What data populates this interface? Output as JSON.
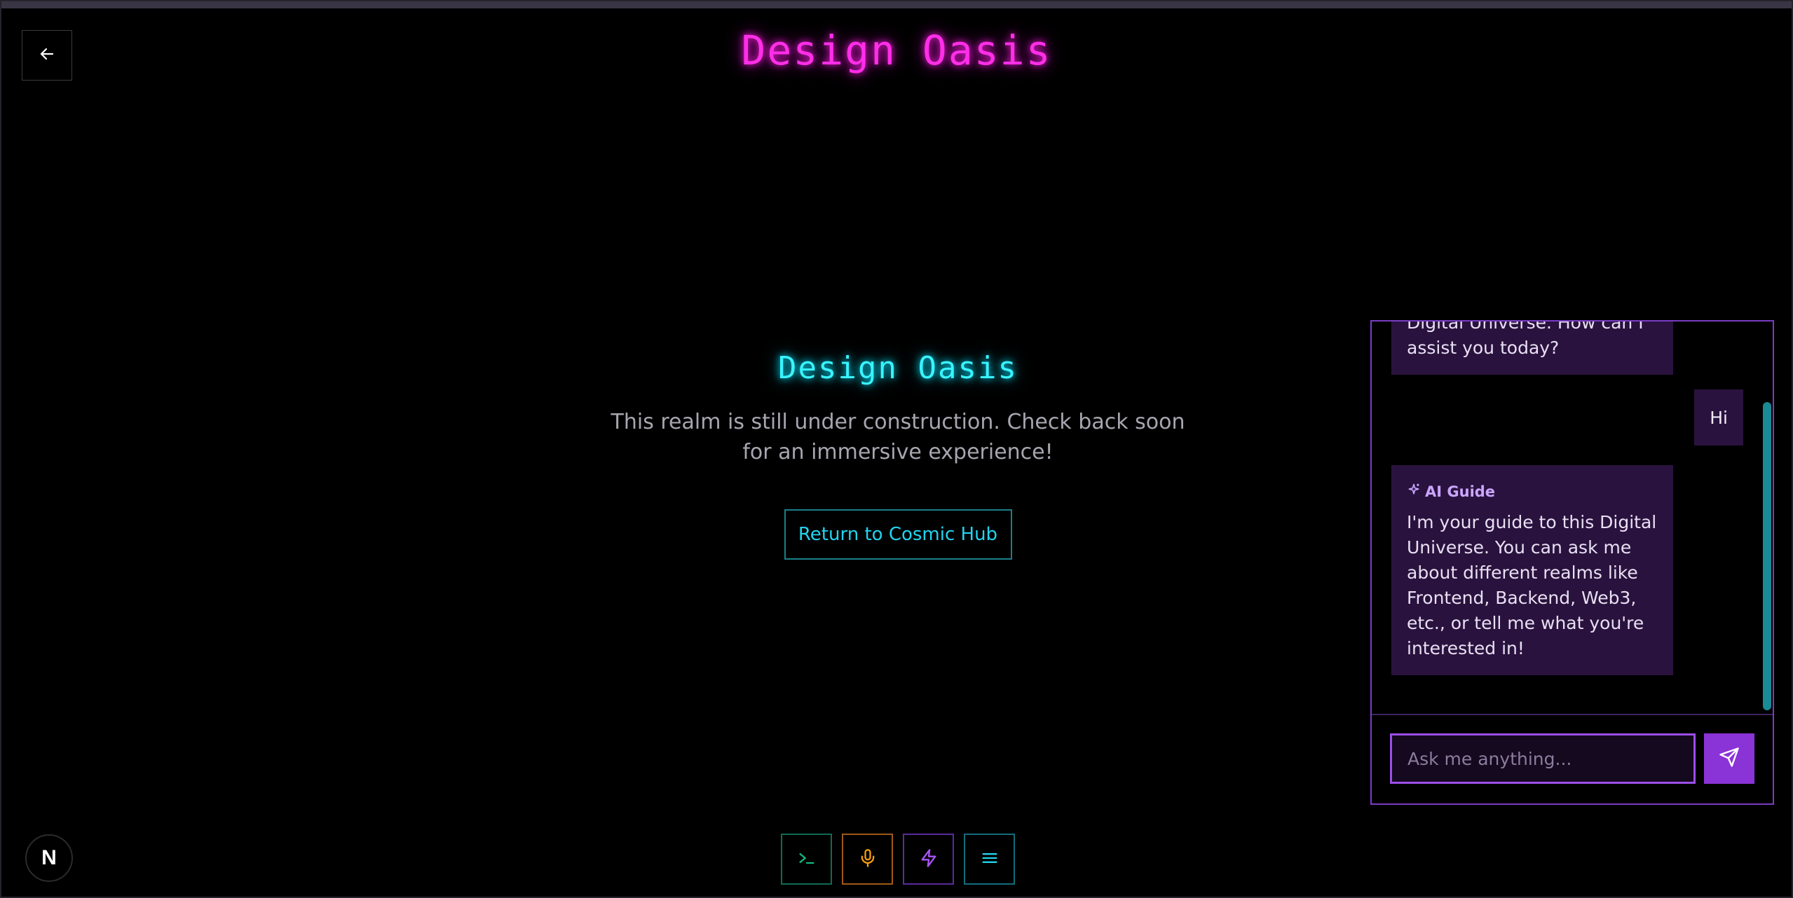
{
  "header": {
    "back_icon": "arrow-left-icon",
    "title": "Design Oasis"
  },
  "main": {
    "realm_title": "Design Oasis",
    "description": "This realm is still under construction. Check back soon for an immersive experience!",
    "return_button": "Return to Cosmic Hub"
  },
  "chat": {
    "messages": [
      {
        "role": "ai",
        "text": "Digital Universe. How can I assist you today?"
      },
      {
        "role": "user",
        "text": "Hi"
      },
      {
        "role": "ai",
        "label": "AI Guide",
        "text": "I'm your guide to this Digital Universe. You can ask me about different realms like Frontend, Backend, Web3, etc., or tell me what you're interested in!"
      }
    ],
    "input_placeholder": "Ask me anything...",
    "input_value": "",
    "send_icon": "send-icon"
  },
  "dock": [
    {
      "icon": "terminal-icon",
      "color": "#10b981"
    },
    {
      "icon": "microphone-icon",
      "color": "#f59e0b"
    },
    {
      "icon": "lightning-icon",
      "color": "#a855f7"
    },
    {
      "icon": "menu-icon",
      "color": "#22d3ee"
    }
  ],
  "badge": {
    "label": "N"
  },
  "colors": {
    "magenta": "#ff2ee8",
    "cyan": "#38f4ff",
    "purple": "#8a33d6",
    "bubble": "#2a123e"
  }
}
